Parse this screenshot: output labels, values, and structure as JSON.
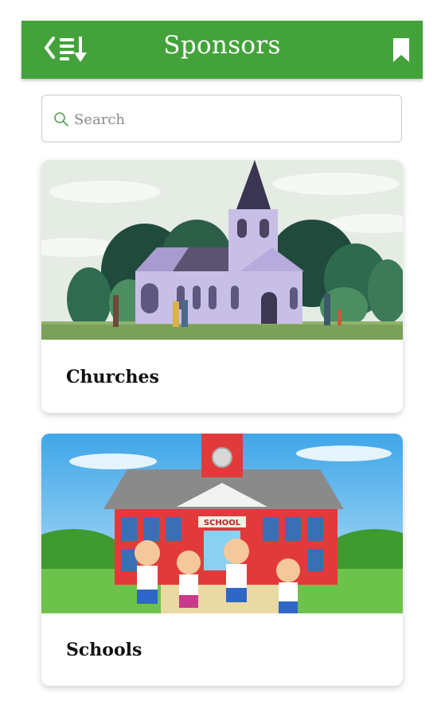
{
  "header": {
    "title": "Sponsors",
    "back_icon": "back-list-icon",
    "bookmark_icon": "bookmark-icon",
    "background_color": "#43a33a"
  },
  "search": {
    "placeholder": "Search",
    "value": "",
    "icon": "search-icon"
  },
  "categories": [
    {
      "label": "Churches",
      "image": "church-illustration"
    },
    {
      "label": "Schools",
      "image": "school-illustration",
      "sign_text": "SCHOOL"
    }
  ]
}
